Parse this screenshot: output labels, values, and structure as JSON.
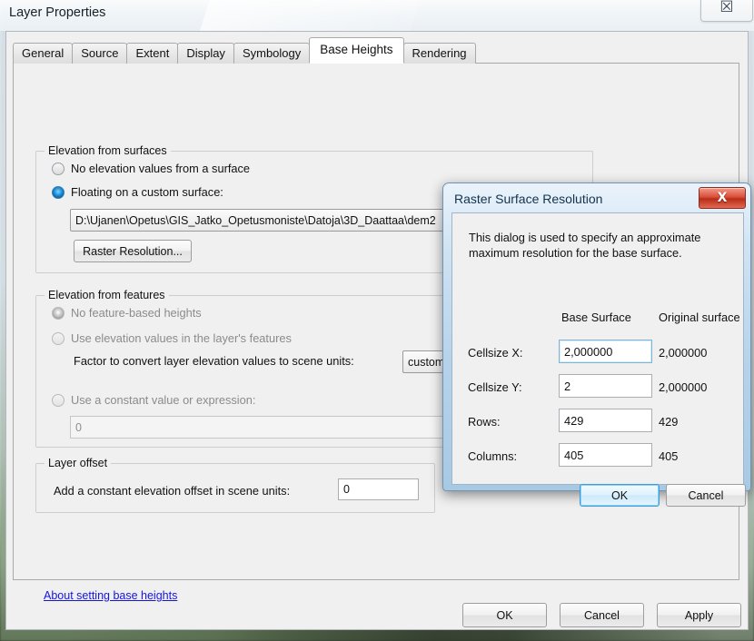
{
  "window": {
    "title": "Layer Properties",
    "close_icon": "close-icon",
    "close_glyph": "☒"
  },
  "tabs": [
    {
      "label": "General",
      "active": false
    },
    {
      "label": "Source",
      "active": false
    },
    {
      "label": "Extent",
      "active": false
    },
    {
      "label": "Display",
      "active": false
    },
    {
      "label": "Symbology",
      "active": false
    },
    {
      "label": "Base Heights",
      "active": true
    },
    {
      "label": "Rendering",
      "active": false
    }
  ],
  "surfaces": {
    "group_title": "Elevation from surfaces",
    "option_none": "No elevation values from a surface",
    "option_floating": "Floating on a custom surface:",
    "selected": "floating",
    "path_value": "D:\\Ujanen\\Opetus\\GIS_Jatko_Opetusmoniste\\Datoja\\3D_Daattaa\\dem2",
    "browse_icon": "open-folder-icon",
    "raster_resolution_button": "Raster Resolution..."
  },
  "features": {
    "group_title": "Elevation from features",
    "option_no_feature": "No feature-based heights",
    "option_use_values": "Use elevation values in the layer's features",
    "selected": "no_feature",
    "factor_label": "Factor to convert layer elevation values to scene units:",
    "factor_value": "custom",
    "option_constant": "Use a constant value or expression:",
    "constant_value": "0"
  },
  "layer_offset": {
    "group_title": "Layer offset",
    "label": "Add a constant elevation offset in scene units:",
    "value": "0"
  },
  "help_link": "About setting base heights",
  "footer": {
    "ok": "OK",
    "cancel": "Cancel",
    "apply": "Apply"
  },
  "modal": {
    "title": "Raster Surface Resolution",
    "close_glyph": "X",
    "description": "This dialog is used to specify an approximate maximum resolution for the base surface.",
    "column_headers": [
      "Base Surface",
      "Original surface"
    ],
    "rows": [
      {
        "label": "Cellsize X:",
        "base": "2,000000",
        "original": "2,000000",
        "focused": true
      },
      {
        "label": "Cellsize Y:",
        "base": "2",
        "original": "2,000000",
        "focused": false
      },
      {
        "label": "Rows:",
        "base": "429",
        "original": "429",
        "focused": false
      },
      {
        "label": "Columns:",
        "base": "405",
        "original": "405",
        "focused": false
      }
    ],
    "ok": "OK",
    "cancel": "Cancel"
  },
  "colors": {
    "accent_blue": "#1c8ad6",
    "link_blue": "#1414e0",
    "close_red": "#b92d18",
    "panel_gray": "#f0f0f0",
    "preview_gold": "#e3b866"
  }
}
